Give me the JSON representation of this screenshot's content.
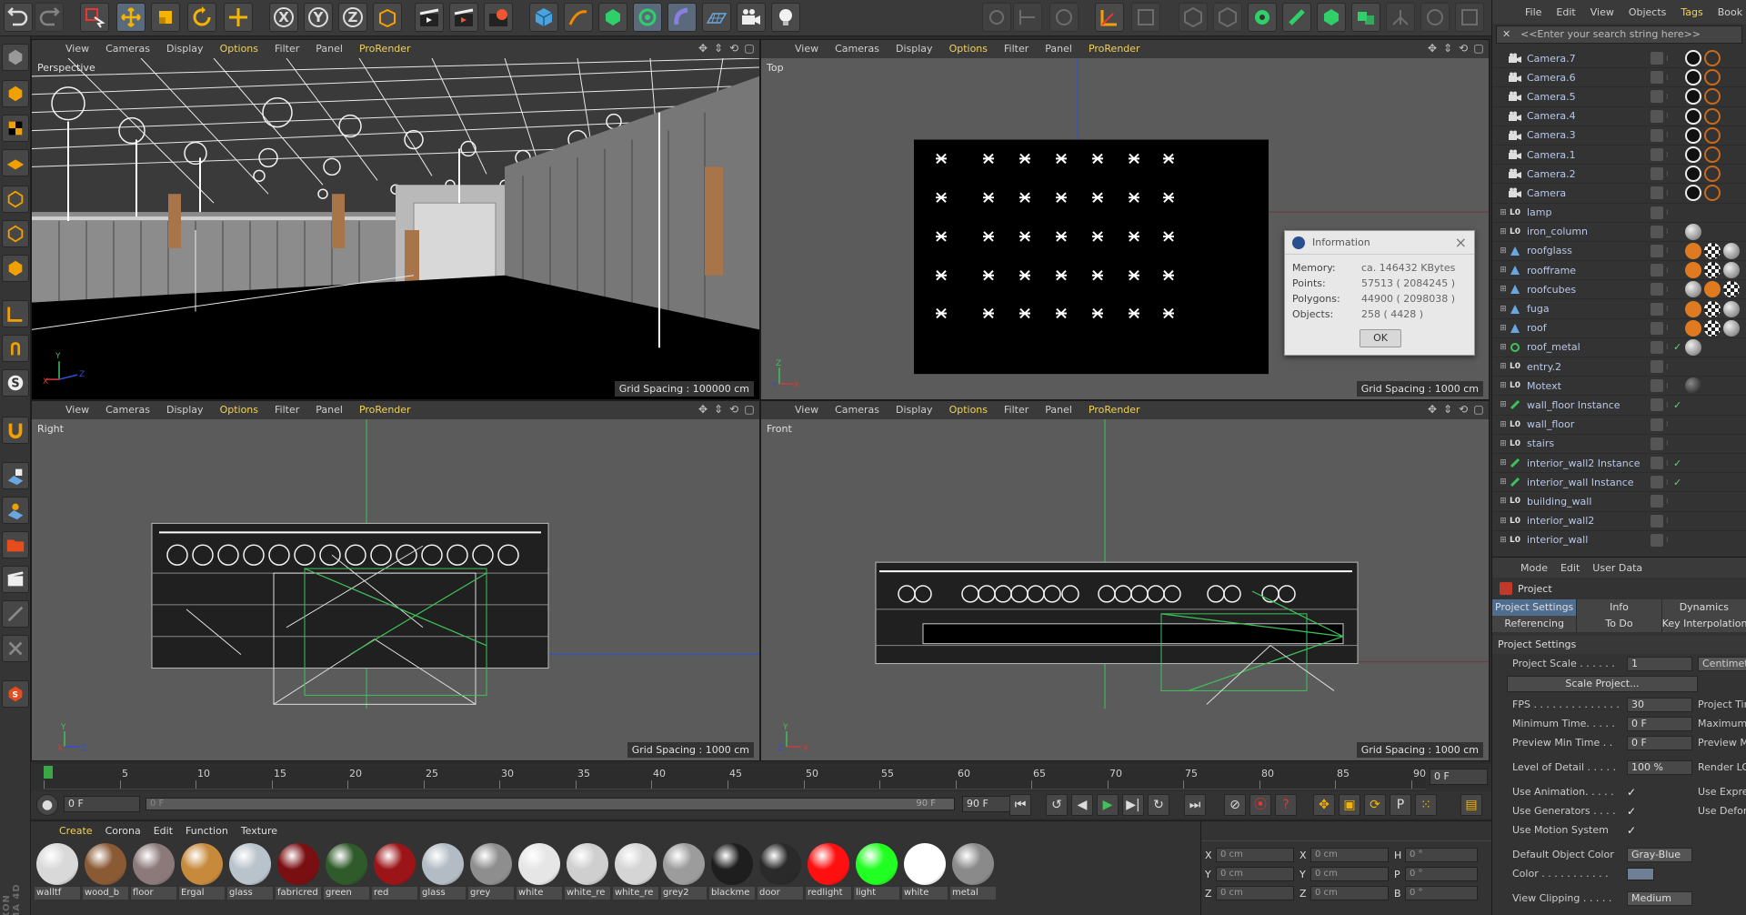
{
  "toolbar": {
    "axis_x": "X",
    "axis_y": "Y",
    "axis_z": "Z"
  },
  "viewport_menu": [
    "View",
    "Cameras",
    "Display",
    "Options",
    "Filter",
    "Panel",
    "ProRender"
  ],
  "viewports": {
    "perspective": {
      "name": "Perspective",
      "grid": "Grid Spacing : 100000 cm"
    },
    "top": {
      "name": "Top",
      "grid": "Grid Spacing : 1000 cm"
    },
    "right": {
      "name": "Right",
      "grid": "Grid Spacing : 1000 cm"
    },
    "front": {
      "name": "Front",
      "grid": "Grid Spacing : 1000 cm"
    }
  },
  "info_dialog": {
    "title": "Information",
    "rows": [
      {
        "k": "Memory:",
        "v": "ca. 146432 KBytes"
      },
      {
        "k": "Points:",
        "v": "57513 ( 2084245 )"
      },
      {
        "k": "Polygons:",
        "v": "44900 ( 2098038 )"
      },
      {
        "k": "Objects:",
        "v": "258 ( 4428 )"
      }
    ],
    "ok": "OK"
  },
  "object_manager": {
    "menu": [
      "File",
      "Edit",
      "View",
      "Objects",
      "Tags",
      "Book"
    ],
    "search_placeholder": "<<Enter your search string here>>",
    "objects": [
      {
        "name": "Camera.7",
        "icon": "camera",
        "tags": [
          "cam",
          "no"
        ]
      },
      {
        "name": "Camera.6",
        "icon": "camera",
        "tags": [
          "cam",
          "no"
        ]
      },
      {
        "name": "Camera.5",
        "icon": "camera",
        "tags": [
          "cam",
          "no"
        ]
      },
      {
        "name": "Camera.4",
        "icon": "camera",
        "tags": [
          "cam",
          "no"
        ]
      },
      {
        "name": "Camera.3",
        "icon": "camera",
        "tags": [
          "cam",
          "no"
        ]
      },
      {
        "name": "Camera.1",
        "icon": "camera",
        "tags": [
          "cam",
          "no"
        ]
      },
      {
        "name": "Camera.2",
        "icon": "camera",
        "tags": [
          "cam",
          "no"
        ]
      },
      {
        "name": "Camera",
        "icon": "camera",
        "tags": [
          "cam",
          "no"
        ]
      },
      {
        "name": "lamp",
        "icon": "null",
        "tags": []
      },
      {
        "name": "iron_column",
        "icon": "null",
        "tags": [
          "mat"
        ]
      },
      {
        "name": "roofglass",
        "icon": "poly",
        "tags": [
          "orange",
          "check",
          "mat"
        ]
      },
      {
        "name": "roofframe",
        "icon": "poly",
        "tags": [
          "orange",
          "check",
          "mat"
        ]
      },
      {
        "name": "roofcubes",
        "icon": "poly",
        "tags": [
          "mat",
          "orange",
          "check"
        ]
      },
      {
        "name": "fuga",
        "icon": "poly",
        "tags": [
          "orange",
          "check",
          "mat"
        ]
      },
      {
        "name": "roof",
        "icon": "poly",
        "tags": [
          "orange",
          "check",
          "mat"
        ]
      },
      {
        "name": "roof_metal",
        "icon": "gen",
        "tags": [
          "mat"
        ],
        "check": true
      },
      {
        "name": "entry.2",
        "icon": "null",
        "tags": []
      },
      {
        "name": "Motext",
        "icon": "null",
        "tags": [
          "dark"
        ]
      },
      {
        "name": "wall_floor Instance",
        "icon": "inst",
        "tags": [],
        "check": true
      },
      {
        "name": "wall_floor",
        "icon": "null",
        "tags": []
      },
      {
        "name": "stairs",
        "icon": "null",
        "tags": []
      },
      {
        "name": "interior_wall2 Instance",
        "icon": "inst",
        "tags": [],
        "check": true
      },
      {
        "name": "interior_wall Instance",
        "icon": "inst",
        "tags": [],
        "check": true
      },
      {
        "name": "building_wall",
        "icon": "null",
        "tags": []
      },
      {
        "name": "interior_wall2",
        "icon": "null",
        "tags": []
      },
      {
        "name": "interior_wall",
        "icon": "null",
        "tags": []
      }
    ]
  },
  "attribute_manager": {
    "menu": [
      "Mode",
      "Edit",
      "User Data"
    ],
    "object": "Project",
    "tabs_row1": [
      "Project Settings",
      "Info",
      "Dynamics"
    ],
    "tabs_row2": [
      "Referencing",
      "To Do",
      "Key Interpolation"
    ],
    "section": "Project Settings",
    "project_scale_label": "Project Scale . . . . . .",
    "project_scale_value": "1",
    "project_scale_unit": "Centimeters",
    "scale_project_btn": "Scale Project...",
    "fps_label": "FPS . . . . . . . . . . . . . .",
    "fps_value": "30",
    "fps_right": "Project Time",
    "min_time_label": "Minimum Time. . . . .",
    "min_time_value": "0 F",
    "min_time_right": "Maximum Time",
    "preview_min_label": "Preview Min Time . .",
    "preview_min_value": "0 F",
    "preview_min_right": "Preview Max Time",
    "lod_label": "Level of Detail . . . . .",
    "lod_value": "100 %",
    "lod_right": "Render LOD",
    "use_anim_label": "Use Animation. . . . .",
    "use_anim_right": "Use Expression",
    "use_gen_label": "Use Generators . . . .",
    "use_gen_right": "Use Deformers",
    "use_motion_label": "Use Motion System",
    "default_color_label": "Default Object Color",
    "default_color_value": "Gray-Blue",
    "color_label": "Color . . . . . . . . . . .",
    "view_clipping_label": "View Clipping . . . . .",
    "view_clipping_value": "Medium",
    "checkmark": "✓"
  },
  "timeline": {
    "ticks": [
      "0",
      "5",
      "10",
      "15",
      "20",
      "25",
      "30",
      "35",
      "40",
      "45",
      "50",
      "55",
      "60",
      "65",
      "70",
      "75",
      "80",
      "85",
      "90"
    ],
    "current_frame": "0 F"
  },
  "transport": {
    "start_field": "0 F",
    "range_start": "0 F",
    "range_end": "90 F",
    "end_field": "90 F"
  },
  "material_manager": {
    "menu": [
      "Create",
      "Corona",
      "Edit",
      "Function",
      "Texture"
    ],
    "materials": [
      {
        "name": "walltf",
        "color": "#d9d9d9"
      },
      {
        "name": "wood_b",
        "color": "#8a5a35"
      },
      {
        "name": "floor",
        "color": "#8c7a7a"
      },
      {
        "name": "Ergal",
        "color": "#c78a3c"
      },
      {
        "name": "glass",
        "color": "#b9c3cc"
      },
      {
        "name": "fabricred",
        "color": "#7a0f12"
      },
      {
        "name": "green",
        "color": "#2f5a2a"
      },
      {
        "name": "red",
        "color": "#9b1518"
      },
      {
        "name": "glass",
        "color": "#b3bcc4"
      },
      {
        "name": "grey",
        "color": "#8e8e8e"
      },
      {
        "name": "white",
        "color": "#e6e6e6"
      },
      {
        "name": "white_re",
        "color": "#cfcfcf"
      },
      {
        "name": "white_re",
        "color": "#d5d5d5"
      },
      {
        "name": "grey2",
        "color": "#9c9c9c"
      },
      {
        "name": "blackme",
        "color": "#1e1e1e"
      },
      {
        "name": "door",
        "color": "#2a2a2a"
      },
      {
        "name": "redlight",
        "color": "#ff1010"
      },
      {
        "name": "light",
        "color": "#22ff22"
      },
      {
        "name": "white",
        "color": "#ffffff"
      },
      {
        "name": "metal",
        "color": "#8a8a8a"
      }
    ]
  },
  "coordinates": {
    "rows": [
      {
        "a1": "X",
        "v1": "0 cm",
        "a2": "X",
        "v2": "0 cm",
        "a3": "H",
        "v3": "0 °"
      },
      {
        "a1": "Y",
        "v1": "0 cm",
        "a2": "Y",
        "v2": "0 cm",
        "a3": "P",
        "v3": "0 °"
      },
      {
        "a1": "Z",
        "v1": "0 cm",
        "a2": "Z",
        "v2": "0 cm",
        "a3": "B",
        "v3": "0 °"
      }
    ]
  },
  "branding": {
    "logo": "MAXON CINEMA 4D"
  },
  "colors": {
    "menu_highlight": "#f2d25a",
    "viewport_bg": "#5b5b5b",
    "axis_y": "#3ec35a",
    "axis_x": "#d23a3a",
    "axis_z": "#2f4fd0"
  }
}
